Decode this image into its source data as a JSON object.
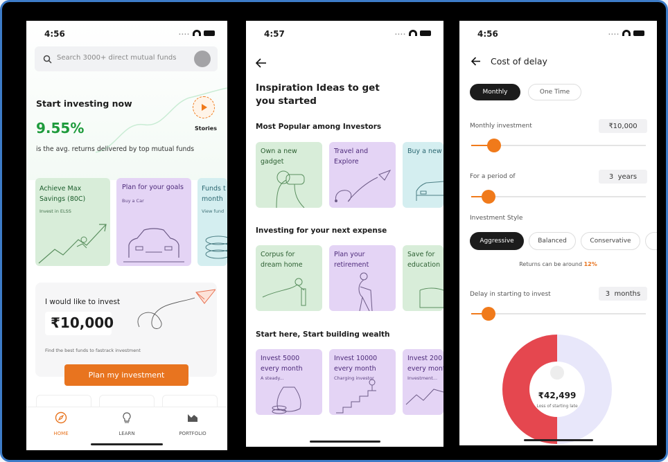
{
  "screens": {
    "home": {
      "time": "4:56",
      "search_placeholder": "Search 3000+ direct mutual funds",
      "start_title": "Start investing now",
      "returns": "9.55%",
      "stories": "Stories",
      "returns_caption": "is the avg. returns delivered by top mutual funds",
      "cards": [
        {
          "title": "Achieve Max Savings (80C)",
          "sub": "Invest in ELSS"
        },
        {
          "title": "Plan for your goals",
          "sub": "Buy a Car"
        },
        {
          "title": "Funds t month",
          "sub": "View fund"
        }
      ],
      "invest_label": "I would like to invest",
      "invest_amount": "₹10,000",
      "invest_caption": "Find the best funds to fastrack investment",
      "plan_button": "Plan my investment",
      "nav": [
        "HOME",
        "LEARN",
        "PORTFOLIO"
      ]
    },
    "inspiration": {
      "time": "4:57",
      "title_line1": "Inspiration Ideas to get",
      "title_line2": "you started",
      "sections": [
        {
          "heading": "Most Popular among Investors",
          "cards": [
            {
              "line1": "Own a new",
              "line2": "gadget",
              "sub": ""
            },
            {
              "line1": "Travel and",
              "line2": "Explore",
              "sub": ""
            },
            {
              "line1": "Buy a new",
              "line2": "",
              "sub": ""
            }
          ]
        },
        {
          "heading": "Investing for your next expense",
          "cards": [
            {
              "line1": "Corpus for",
              "line2": "dream home",
              "sub": ""
            },
            {
              "line1": "Plan your",
              "line2": "retirement",
              "sub": ""
            },
            {
              "line1": "Save for",
              "line2": "education",
              "sub": ""
            }
          ]
        },
        {
          "heading": "Start here, Start building wealth",
          "cards": [
            {
              "line1": "Invest 5000",
              "line2": "every month",
              "sub": "A steady..."
            },
            {
              "line1": "Invest 10000",
              "line2": "every month",
              "sub": "Charging investor"
            },
            {
              "line1": "Invest 200",
              "line2": "every mont",
              "sub": "Investment..."
            }
          ]
        }
      ]
    },
    "delay": {
      "time": "4:56",
      "title": "Cost of delay",
      "toggle": [
        "Monthly",
        "One Time"
      ],
      "monthly_label": "Monthly investment",
      "monthly_value": "₹10,000",
      "monthly_slider": 0.13,
      "period_label": "For a period of",
      "period_value": "3  years",
      "period_slider": 0.1,
      "style_label": "Investment Style",
      "styles": [
        "Aggressive",
        "Balanced",
        "Conservative"
      ],
      "returns_text": "Returns can be around",
      "returns_pct": "12%",
      "delay_label": "Delay in starting to invest",
      "delay_value": "3  months",
      "delay_slider": 0.1,
      "loss_amount": "₹42,499",
      "loss_caption": "Loss of starting late",
      "loss_fraction": 0.5
    }
  }
}
